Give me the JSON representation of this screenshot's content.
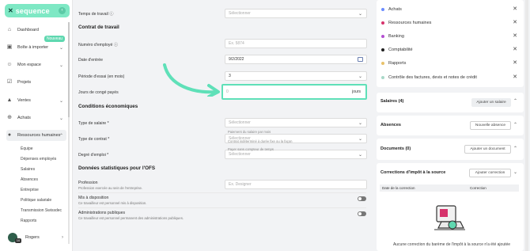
{
  "brand": {
    "name": "sequence"
  },
  "sidebar": {
    "items": [
      {
        "label": "Dashboard",
        "icon": "home-icon"
      },
      {
        "label": "Boîte à importer",
        "icon": "inbox-icon"
      },
      {
        "label": "Mon espace",
        "icon": "user-icon"
      },
      {
        "label": "Projets",
        "icon": "check-square-icon"
      },
      {
        "label": "Ventes",
        "icon": "lock-icon"
      },
      {
        "label": "Achats",
        "icon": "cart-icon"
      },
      {
        "label": "Ressources humaines",
        "icon": "people-icon"
      }
    ],
    "new_badge": "Nouveau",
    "sub_items": [
      "Équipe",
      "Dépenses employés",
      "Salaires",
      "Absences",
      "Entreprise",
      "Politique salariale",
      "Transmission Swissdec",
      "Rapports"
    ],
    "user": {
      "name": "Rogers",
      "badge": "10"
    }
  },
  "form": {
    "temps_travail": {
      "label": "Temps de travail",
      "placeholder": "Sélectionner"
    },
    "section_contrat": "Contrat de travail",
    "numero_employe": {
      "label": "Numéro d'employé",
      "placeholder": "Ex. 5874"
    },
    "date_entree": {
      "label": "Date d'entrée",
      "value": "9/2/2022"
    },
    "periode_essai": {
      "label": "Période d'essai (en mois)",
      "value": "3"
    },
    "jours_conge": {
      "label": "Jours de congé payés",
      "value": "0",
      "unit": "jours"
    },
    "section_conditions": "Conditions économiques",
    "type_salaire": {
      "label": "Type de salaire *",
      "placeholder": "Sélectionner",
      "hint": "Paiement du salaire par mois"
    },
    "type_contrat": {
      "label": "Type de contrat *",
      "placeholder": "Sélectionner",
      "hint": "Contrat indéterminé à durée fixe ou la façon"
    },
    "degre_emploi": {
      "label": "Degré d'emploi *",
      "placeholder": "Sélectionner",
      "hint": "Payer sans compteur de temps"
    },
    "section_ofs": "Données statistiques pour l'OFS",
    "profession": {
      "label": "Profession",
      "desc": "Profession exercée au sein de l'entreprise.",
      "placeholder": "Ex. Designer"
    },
    "mis_disposition": {
      "label": "Mis à disposition",
      "desc": "Ce travailleur est personnel mis à disposition."
    },
    "admin_publiques": {
      "label": "Administrations publiques",
      "desc": "Ce travailleur est personnel permanent des administrations publiques."
    }
  },
  "right": {
    "categories": [
      {
        "label": "Achats",
        "color": "#6b8cff"
      },
      {
        "label": "Ressources humaines",
        "color": "#d6336c"
      },
      {
        "label": "Banking",
        "color": "#b44fd1"
      },
      {
        "label": "Comptabilité",
        "color": "#1f1f1f"
      },
      {
        "label": "Rapports",
        "color": "#e8c26a"
      },
      {
        "label": "Contrôle des factures, devis et notes de crédit",
        "color": "#a8d8c8"
      }
    ],
    "salaires": {
      "title": "Salaires (4)",
      "button": "Ajouter un salaire"
    },
    "absences": {
      "title": "Absences",
      "button": "Nouvelle absence"
    },
    "documents": {
      "title": "Documents (0)",
      "button": "Ajouter un document"
    },
    "corrections": {
      "title": "Corrections d'impôt à la source",
      "button": "Ajouter correction",
      "columns": [
        "Date de la correction",
        "Correction"
      ],
      "empty": "Aucune correction du barème de l'impôt à la source n'a été ajoutée"
    }
  }
}
